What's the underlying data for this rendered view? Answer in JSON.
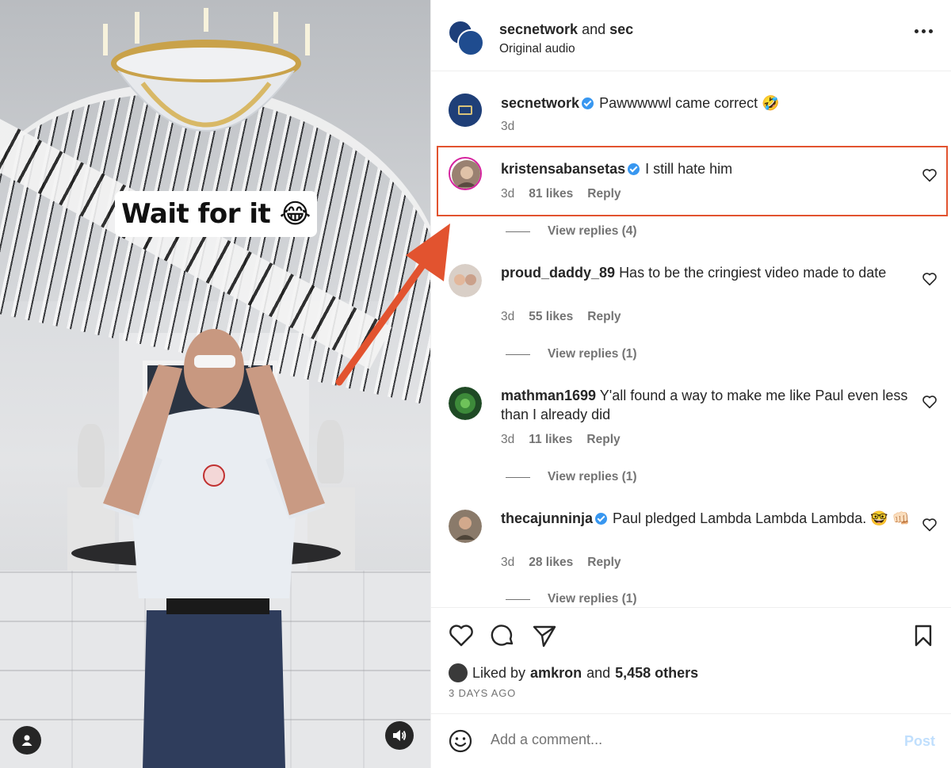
{
  "media": {
    "caption_text": "Wait for it",
    "caption_emoji": "😂",
    "profile_icon": "user-icon",
    "sound_icon": "speaker-icon"
  },
  "header": {
    "account_primary": "secnetwork",
    "and_text": "and",
    "account_secondary": "sec",
    "subtitle": "Original audio",
    "more_icon": "more-horizontal-icon"
  },
  "comments": [
    {
      "user": "secnetwork",
      "verified": true,
      "text": "Pawwwwwl came correct 🤣",
      "time": "3d"
    },
    {
      "user": "kristensabansetas",
      "verified": true,
      "text": "I still hate him",
      "time": "3d",
      "likes": "81 likes",
      "reply": "Reply",
      "view_replies": "View replies (4)"
    },
    {
      "user": "proud_daddy_89",
      "verified": false,
      "text": "Has to be the cringiest video made to date",
      "time": "3d",
      "likes": "55 likes",
      "reply": "Reply",
      "view_replies": "View replies (1)"
    },
    {
      "user": "mathman1699",
      "verified": false,
      "text": "Y'all found a way to make me like Paul even less than I already did",
      "time": "3d",
      "likes": "11 likes",
      "reply": "Reply",
      "view_replies": "View replies (1)"
    },
    {
      "user": "thecajunninja",
      "verified": true,
      "text": "Paul pledged Lambda Lambda Lambda. 🤓 👊🏻",
      "time": "3d",
      "likes": "28 likes",
      "reply": "Reply",
      "view_replies": "View replies (1)"
    }
  ],
  "actions": {
    "like_icon": "heart-icon",
    "comment_icon": "comment-icon",
    "share_icon": "send-icon",
    "save_icon": "bookmark-icon",
    "liked_by_prefix": "Liked by",
    "liked_by_user": "amkron",
    "liked_by_and": "and",
    "liked_by_others": "5,458 others",
    "date": "3 DAYS AGO"
  },
  "add_comment": {
    "placeholder": "Add a comment...",
    "post_label": "Post",
    "emoji_icon": "smiley-icon"
  },
  "colors": {
    "highlight": "#e2532f",
    "verified": "#3897f0",
    "post_disabled": "#c0dffd",
    "secondary_text": "#737373"
  }
}
